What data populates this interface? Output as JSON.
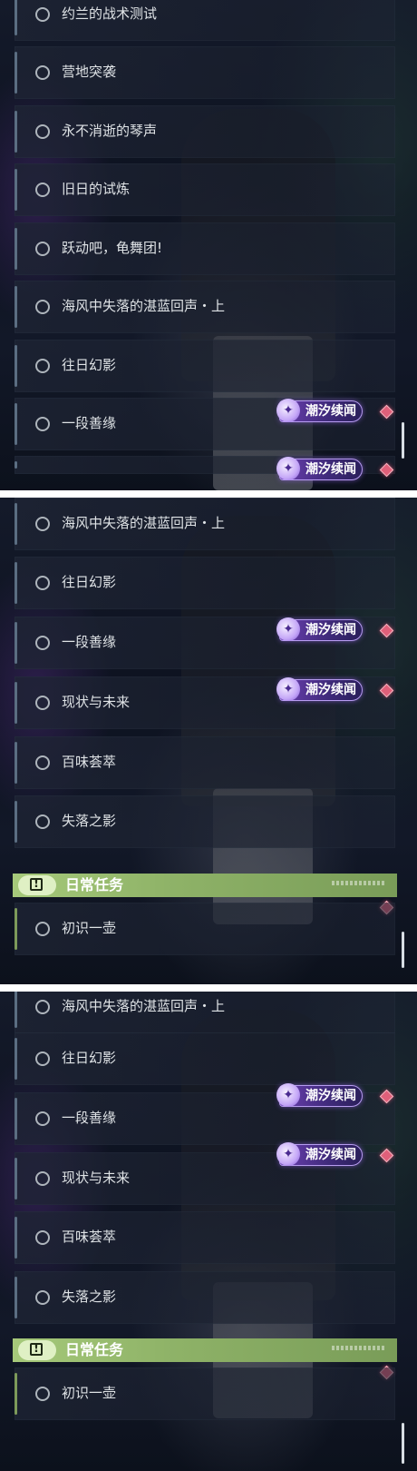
{
  "panel1": {
    "quests": [
      {
        "label": "约兰的战术测试"
      },
      {
        "label": "营地突袭"
      },
      {
        "label": "永不消逝的琴声"
      },
      {
        "label": "旧日的试炼"
      },
      {
        "label": "跃动吧，龟舞团!"
      },
      {
        "label": "海风中失落的湛蓝回声・上"
      },
      {
        "label": "往日幻影"
      },
      {
        "label": "一段善缘"
      }
    ],
    "badges": [
      {
        "text": "潮汐续闻"
      },
      {
        "text": "潮汐续闻"
      }
    ]
  },
  "panel2": {
    "quests": [
      {
        "label": "海风中失落的湛蓝回声・上"
      },
      {
        "label": "往日幻影"
      },
      {
        "label": "一段善缘"
      },
      {
        "label": "现状与未来"
      },
      {
        "label": "百味荟萃"
      },
      {
        "label": "失落之影"
      }
    ],
    "badges": [
      {
        "text": "潮汐续闻"
      },
      {
        "text": "潮汐续闻"
      }
    ],
    "section": {
      "title": "日常任务",
      "icon": "!"
    },
    "daily": [
      {
        "label": "初识一壶"
      }
    ]
  },
  "panel3": {
    "quests": [
      {
        "label": "海风中失落的湛蓝回声・上"
      },
      {
        "label": "往日幻影"
      },
      {
        "label": "一段善缘"
      },
      {
        "label": "现状与未来"
      },
      {
        "label": "百味荟萃"
      },
      {
        "label": "失落之影"
      }
    ],
    "badges": [
      {
        "text": "潮汐续闻"
      },
      {
        "text": "潮汐续闻"
      }
    ],
    "section": {
      "title": "日常任务",
      "icon": "!"
    },
    "daily": [
      {
        "label": "初识一壶"
      }
    ]
  },
  "colors": {
    "accent_section": "#8fb368",
    "badge_purple": "#6b3fb0",
    "marker_red": "#e0607a"
  }
}
